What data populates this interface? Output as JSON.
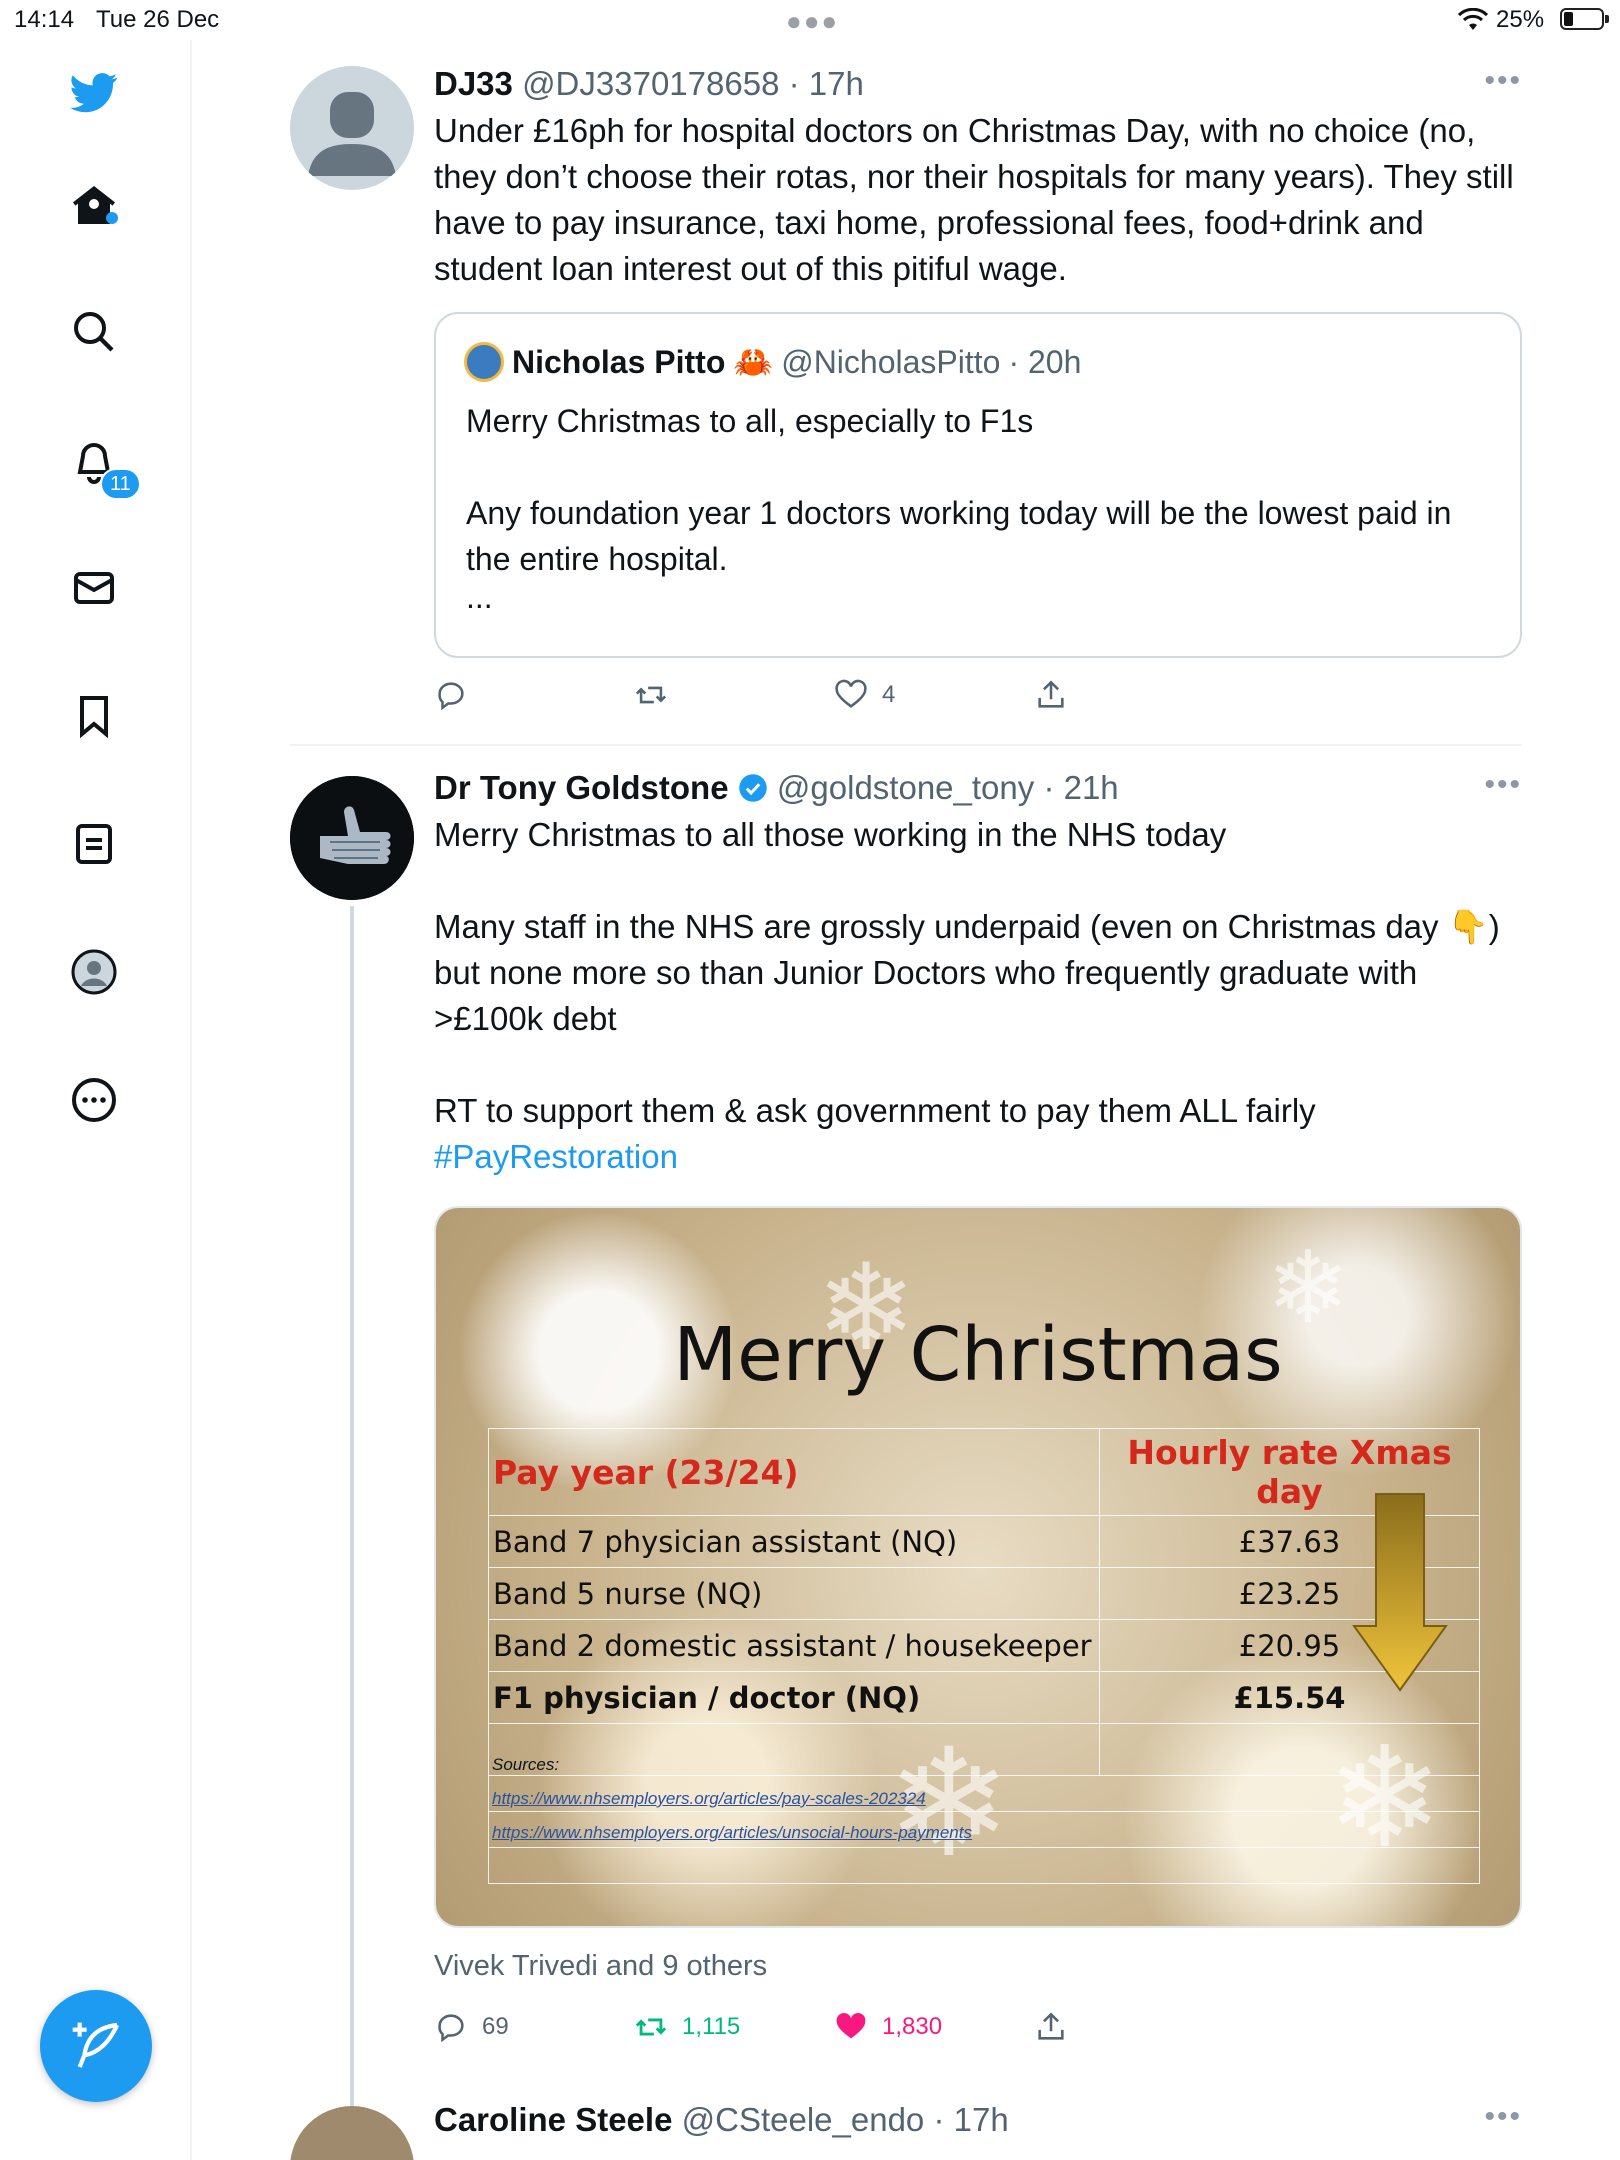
{
  "status_bar": {
    "time": "14:14",
    "date": "Tue 26 Dec",
    "battery": "25%",
    "battery_level": 0.25
  },
  "sidebar": {
    "notification_count": "11",
    "icons": [
      "twitter-logo-icon",
      "home-icon",
      "search-icon",
      "notifications-icon",
      "messages-icon",
      "bookmarks-icon",
      "lists-icon",
      "profile-icon",
      "more-icon"
    ],
    "accent": "#1d9bf0"
  },
  "tweet1": {
    "name": "DJ33",
    "handle": "@DJ3370178658",
    "time": "· 17h",
    "text": "Under £16ph for hospital doctors on Christmas Day, with no choice (no, they don’t choose their rotas, nor their hospitals for many years).  They still have to pay insurance, taxi home, professional fees, food+drink and student loan interest out of this pitiful wage.",
    "quote": {
      "name": "Nicholas Pitto",
      "emoji": "🦀",
      "handle": "@NicholasPitto",
      "time": "· 20h",
      "line1": "Merry Christmas to all, especially to F1s",
      "line2": "Any foundation year 1 doctors  working today will be the lowest paid in the entire hospital.",
      "line3": "..."
    },
    "likes": "4"
  },
  "tweet2": {
    "name": "Dr Tony Goldstone",
    "handle": "@goldstone_tony",
    "time": "· 21h",
    "p1": "Merry Christmas to all those working in the NHS today",
    "p2": "Many staff in the NHS are grossly underpaid (even on Christmas day 👇) but none more so than Junior Doctors who frequently graduate with >£100k debt",
    "p3": "RT to support them & ask government to pay them ALL fairly",
    "hashtag": "#PayRestoration",
    "image": {
      "title": "Merry Christmas",
      "col1": "Pay year (23/24)",
      "col2": "Hourly rate Xmas day",
      "rows": [
        {
          "label": "Band 7 physician assistant (NQ)",
          "rate": "£37.63"
        },
        {
          "label": "Band 5 nurse (NQ)",
          "rate": "£23.25"
        },
        {
          "label": "Band 2 domestic assistant / housekeeper",
          "rate": "£20.95"
        },
        {
          "label": "F1 physician / doctor (NQ)",
          "rate": "£15.54"
        }
      ],
      "sources_label": "Sources:",
      "source1": "https://www.nhsemployers.org/articles/pay-scales-202324",
      "source2": "https://www.nhsemployers.org/articles/unsocial-hours-payments"
    },
    "liked_by": "Vivek Trivedi and 9 others",
    "replies": "69",
    "retweets": "1,115",
    "likes": "1,830",
    "retweet_color": "#00ba7c",
    "like_color": "#f91880"
  },
  "tweet3": {
    "name": "Caroline Steele",
    "handle": "@CSteele_endo",
    "time": "· 17h"
  }
}
